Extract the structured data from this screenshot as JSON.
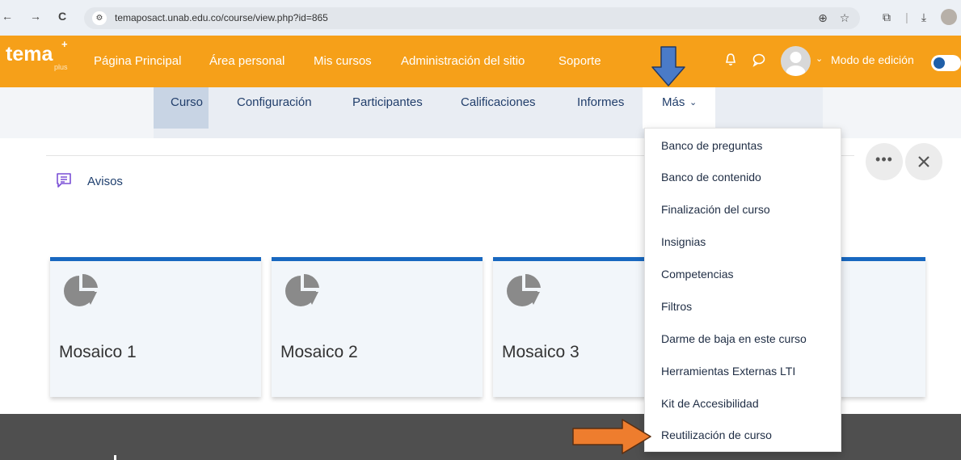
{
  "browser": {
    "url": "temaposact.unab.edu.co/course/view.php?id=865",
    "back_glyph": "←",
    "forward_glyph": "→",
    "reload_glyph": "C",
    "zoom_glyph": "⊕",
    "star_glyph": "☆",
    "extensions_glyph": "⧉",
    "separator_glyph": "|",
    "download_glyph": "⤓"
  },
  "navbar": {
    "logo_text": "tema",
    "logo_plus_sign": "+",
    "logo_sub": "plus",
    "links": [
      "Página Principal",
      "Área personal",
      "Mis cursos",
      "Administración del sitio",
      "Soporte"
    ],
    "chevron": "⌄",
    "edit_mode_label": "Modo de edición"
  },
  "secnav": {
    "tabs": [
      "Curso",
      "Configuración",
      "Participantes",
      "Calificaciones",
      "Informes",
      "Más"
    ],
    "mas_chevron": "⌄"
  },
  "content": {
    "avisos_label": "Avisos",
    "more_glyph": "•••",
    "tiles": [
      "Mosaico 1",
      "Mosaico 2",
      "Mosaico 3"
    ]
  },
  "dropdown": {
    "items": [
      "Banco de preguntas",
      "Banco de contenido",
      "Finalización del curso",
      "Insignias",
      "Competencias",
      "Filtros",
      "Darme de baja en este curso",
      "Herramientas Externas LTI",
      "Kit de Accesibilidad",
      "Reutilización de curso"
    ]
  },
  "colors": {
    "navbar": "#f6a019",
    "tile_accent": "#1868c0",
    "down_arrow": "#4a7bc8",
    "right_arrow": "#ee7d2e"
  }
}
